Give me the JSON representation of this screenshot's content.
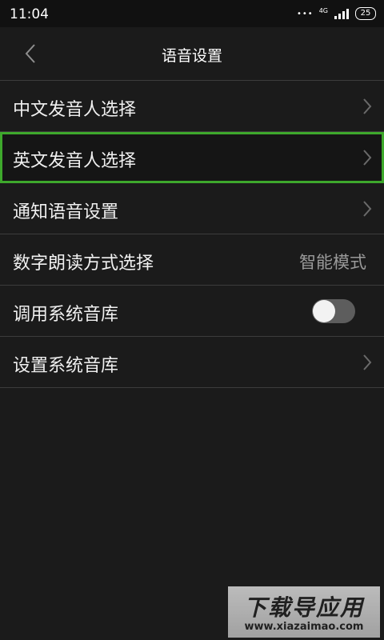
{
  "status_bar": {
    "time": "11:04",
    "network": "4G",
    "battery": "25"
  },
  "title_bar": {
    "title": "语音设置"
  },
  "settings": {
    "items": [
      {
        "label": "中文发音人选择"
      },
      {
        "label": "英文发音人选择"
      },
      {
        "label": "通知语音设置"
      },
      {
        "label": "数字朗读方式选择",
        "value": "智能模式"
      },
      {
        "label": "调用系统音库",
        "toggle": false
      },
      {
        "label": "设置系统音库"
      }
    ]
  },
  "colors": {
    "background": "#1b1b1b",
    "status_bar": "#111111",
    "divider": "#3c3c3c",
    "highlight": "#3ea82c",
    "toggle_off": "#5d5d5d"
  },
  "watermark": {
    "main": "下载导应用",
    "sub": "www.xiazaimao.com"
  }
}
